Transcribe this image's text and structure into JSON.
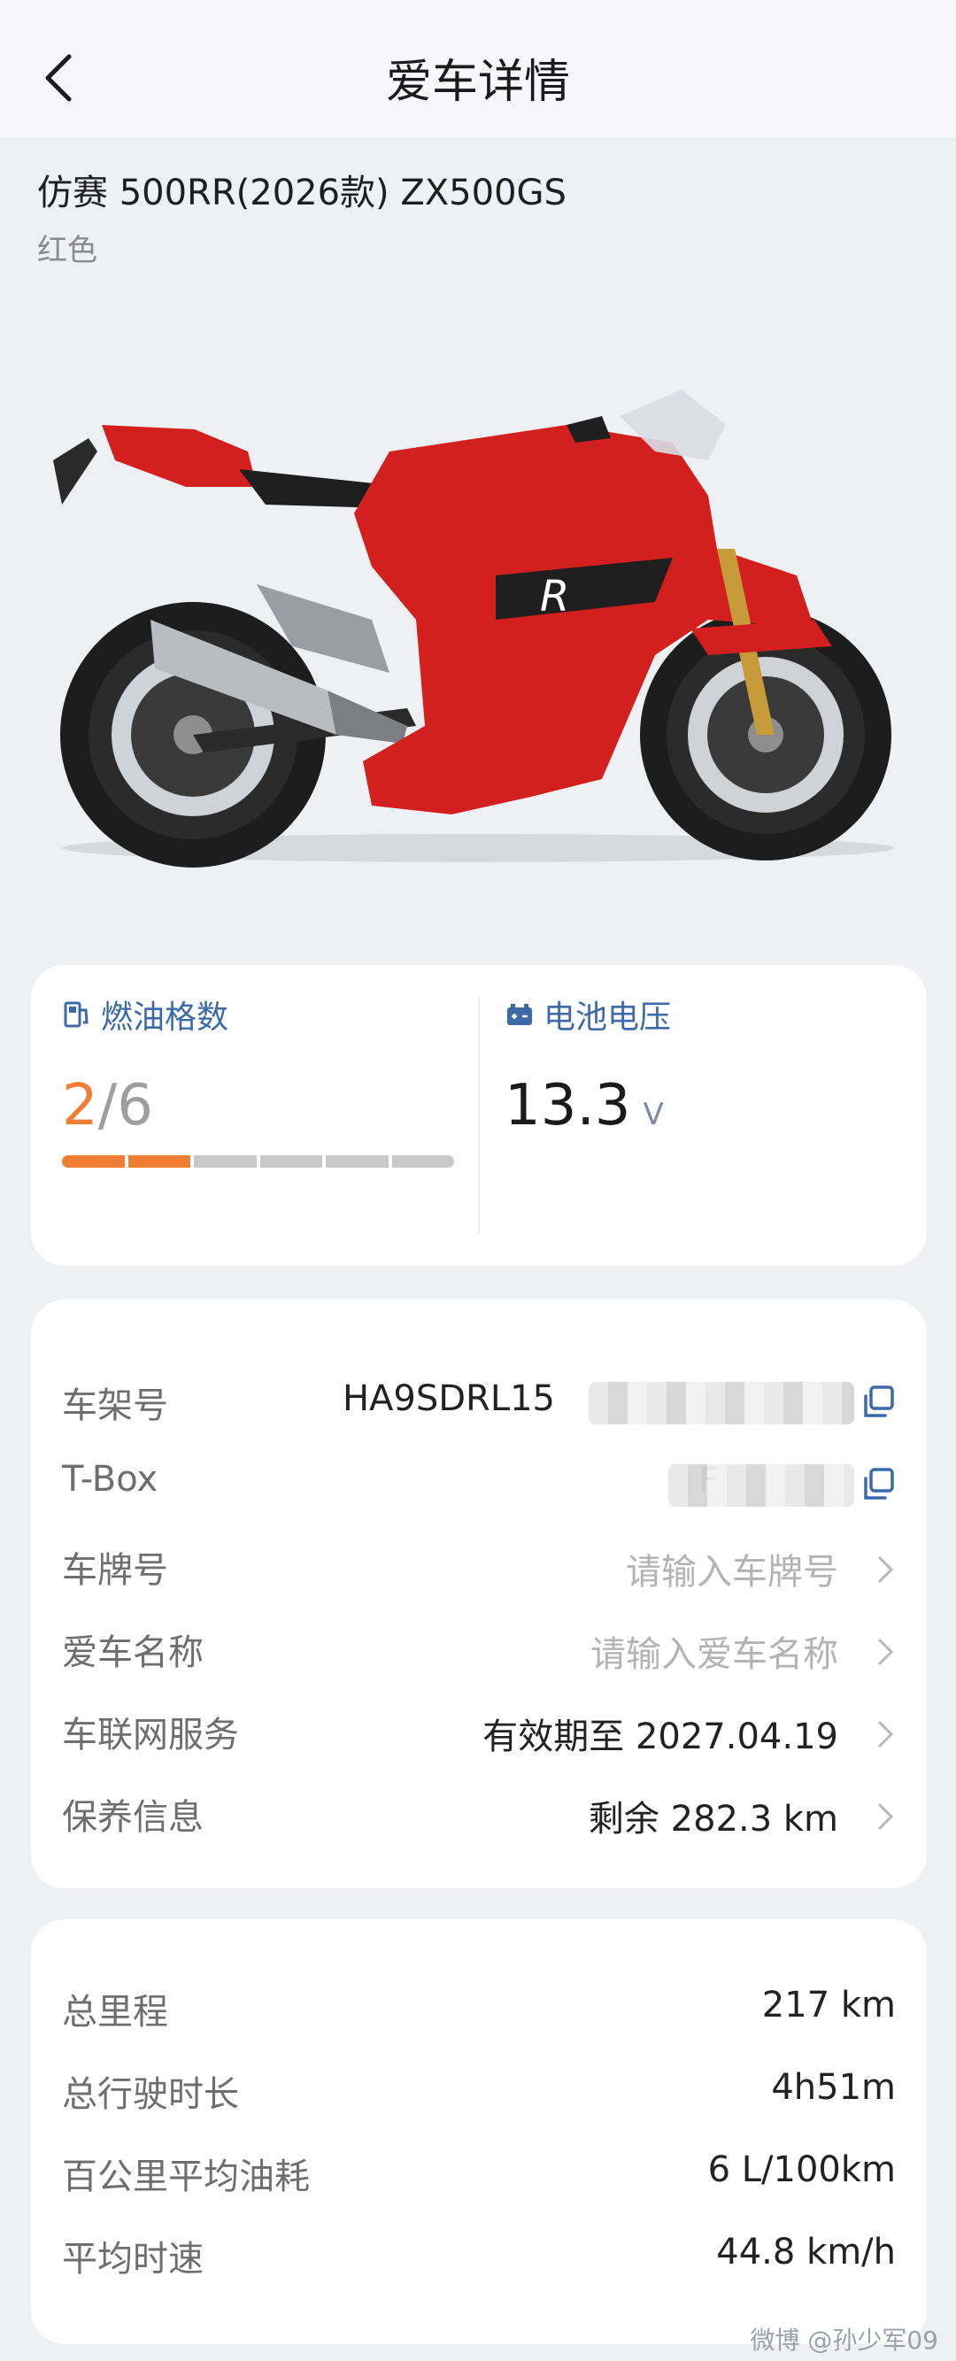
{
  "header": {
    "title": "爱车详情"
  },
  "vehicle": {
    "model": "仿赛 500RR(2026款) ZX500GS",
    "color": "红色"
  },
  "status": {
    "fuel": {
      "label": "燃油格数",
      "current": "2",
      "separator": "/",
      "max": "6",
      "filled_segments": 2,
      "total_segments": 6,
      "accent": "#f07e36"
    },
    "battery": {
      "label": "电池电压",
      "value": "13.3",
      "unit": "V"
    }
  },
  "info": {
    "vin": {
      "label": "车架号",
      "value": "HA9SDRL15"
    },
    "tbox": {
      "label": "T-Box",
      "value": "F"
    },
    "plate": {
      "label": "车牌号",
      "placeholder": "请输入车牌号"
    },
    "name": {
      "label": "爱车名称",
      "placeholder": "请输入爱车名称"
    },
    "iot": {
      "label": "车联网服务",
      "value": "有效期至 2027.04.19"
    },
    "maintenance": {
      "label": "保养信息",
      "value": "剩余 282.3 km"
    }
  },
  "stats": {
    "total_mileage": {
      "label": "总里程",
      "value": "217 km"
    },
    "total_time": {
      "label": "总行驶时长",
      "value": "4h51m"
    },
    "avg_fuel": {
      "label": "百公里平均油耗",
      "value": "6 L/100km"
    },
    "avg_speed": {
      "label": "平均时速",
      "value": "44.8 km/h"
    }
  },
  "watermark": "微博 @孙少军09",
  "colors": {
    "label_blue": "#3c6aa8",
    "bike_red": "#d41f1f",
    "background": "#eff0f4"
  }
}
